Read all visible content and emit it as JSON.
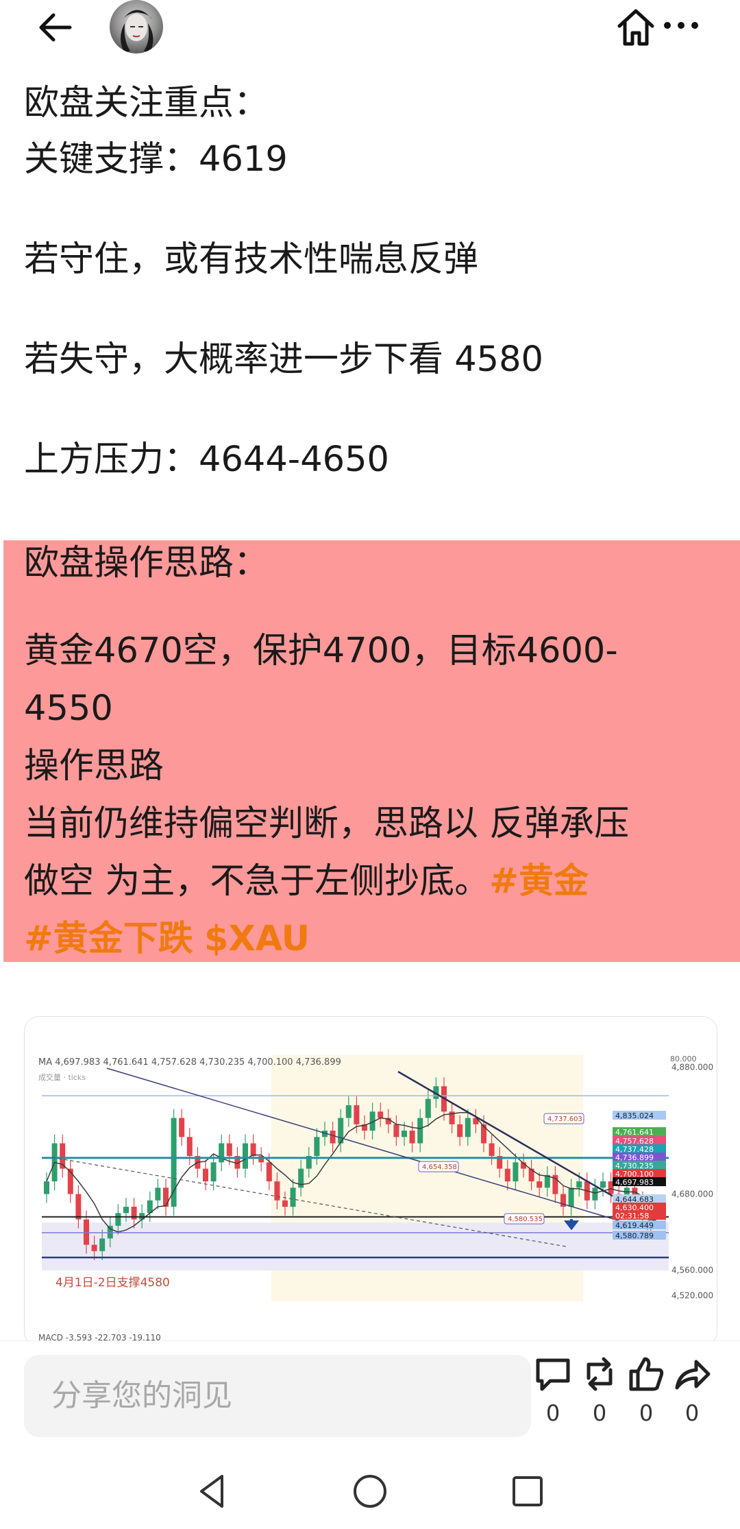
{
  "header": {
    "back_icon": "arrow-left-icon",
    "home_icon": "home-icon",
    "more_icon": "more-dots-icon"
  },
  "post": {
    "lines": {
      "l1": "欧盘关注重点：",
      "l2": "关键支撑：4619",
      "l3": "若守住，或有技术性喘息反弹",
      "l4": "若失守，大概率进一步下看 4580",
      "l5": "上方压力：4644-4650"
    },
    "plan": {
      "title": "欧盘操作思路：",
      "trade_line1": "黄金4670空，保护4700，目标4600-",
      "trade_line2": "4550",
      "subtitle": "操作思路",
      "body_line1": "当前仍维持偏空判断，思路以 反弹承压",
      "body_line2": "做空 为主，不急于左侧抄底。",
      "tag1": "#黄金",
      "tag2": "#黄金下跌",
      "tag3": "$XAU"
    },
    "highlight_color": "#fe9999",
    "tag_color": "#f07a10"
  },
  "chart": {
    "ma_label": "MA",
    "ma_values": [
      "4,697.983",
      "4,761.641",
      "4,757.628",
      "4,730.235",
      "4,700.100",
      "4,736.899"
    ],
    "volume_label": "成交量 · ticks",
    "y_ticks": [
      "4,880.000",
      "4,680.000",
      "4,560.000",
      "4,520.000"
    ],
    "price_tags": [
      "4,835.024",
      "4,761.641",
      "4,757.628",
      "4,737.428",
      "4,736.899",
      "4,730.235",
      "4,700.100",
      "4,697.983",
      "4,644.683",
      "4,630.400",
      "02:31:58",
      "4,619.449",
      "4,580.789"
    ],
    "annotations": {
      "a1": "4,737.603",
      "a2": "4,654.358",
      "a3": "4,580.535"
    },
    "support_note": "4月1日-2日支撑4580",
    "macd_label": "MACD",
    "macd_values": [
      "-3.593",
      "-22.703",
      "-19.110"
    ],
    "top_tick": "80.000"
  },
  "comment_bar": {
    "placeholder": "分享您的洞见",
    "comment_count": "0",
    "repost_count": "0",
    "like_count": "0",
    "share_count": "0"
  }
}
